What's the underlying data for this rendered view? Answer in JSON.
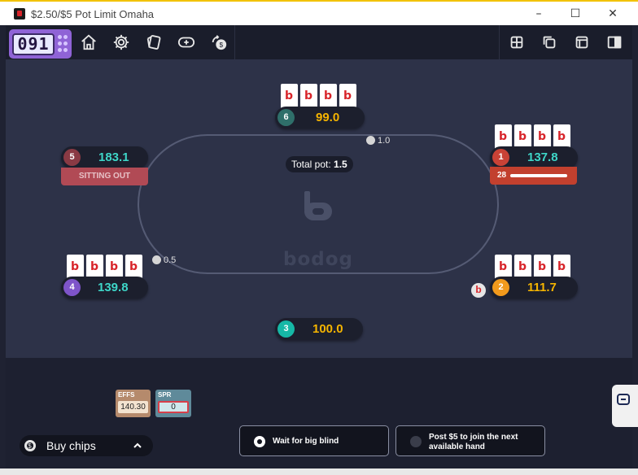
{
  "window": {
    "title": "$2.50/$5 Pot Limit Omaha",
    "minimize_icon": "–",
    "maximize_icon": "☐",
    "close_icon": "✕"
  },
  "toolbar": {
    "timer": "091",
    "icons": [
      "home-icon",
      "gear-icon",
      "cards-icon",
      "add-table-icon",
      "cashier-icon"
    ],
    "layout_icons": [
      "grid-layout-icon",
      "cascade-layout-icon",
      "window-layout-icon",
      "sidebar-layout-icon"
    ]
  },
  "table": {
    "pot_label": "Total pot:",
    "pot_value": "1.5",
    "brand": "bodog",
    "bets": [
      {
        "seat": "6",
        "amount": "1.0"
      },
      {
        "seat": "4",
        "amount": "0.5"
      }
    ],
    "card_back_letter": "b"
  },
  "seats": [
    {
      "number": "6",
      "stack": "99.0",
      "color": "#2f6f6a",
      "stack_color": "#f5b400"
    },
    {
      "number": "1",
      "stack": "137.8",
      "color": "#c94236",
      "stack_color": "#3ed6c8",
      "timer": "28",
      "time_left": 0.85
    },
    {
      "number": "5",
      "stack": "183.1",
      "color": "#8a3a44",
      "stack_color": "#3ed6c8",
      "status": "SITTING OUT"
    },
    {
      "number": "4",
      "stack": "139.8",
      "color": "#7e54c9",
      "stack_color": "#3ed6c8"
    },
    {
      "number": "2",
      "stack": "111.7",
      "color": "#f29a1c",
      "stack_color": "#f5b400"
    },
    {
      "number": "3",
      "stack": "100.0",
      "color": "#16b8a6",
      "stack_color": "#f5b400"
    }
  ],
  "dealer_button": "b",
  "stats": {
    "effs": {
      "label": "EFFS",
      "value": "140.30"
    },
    "spr": {
      "label": "SPR",
      "value": "0"
    }
  },
  "bottom": {
    "buy_chips": "Buy chips",
    "wait_big_blind": "Wait for big blind",
    "post_to_join": "Post $5 to join the next available hand"
  }
}
